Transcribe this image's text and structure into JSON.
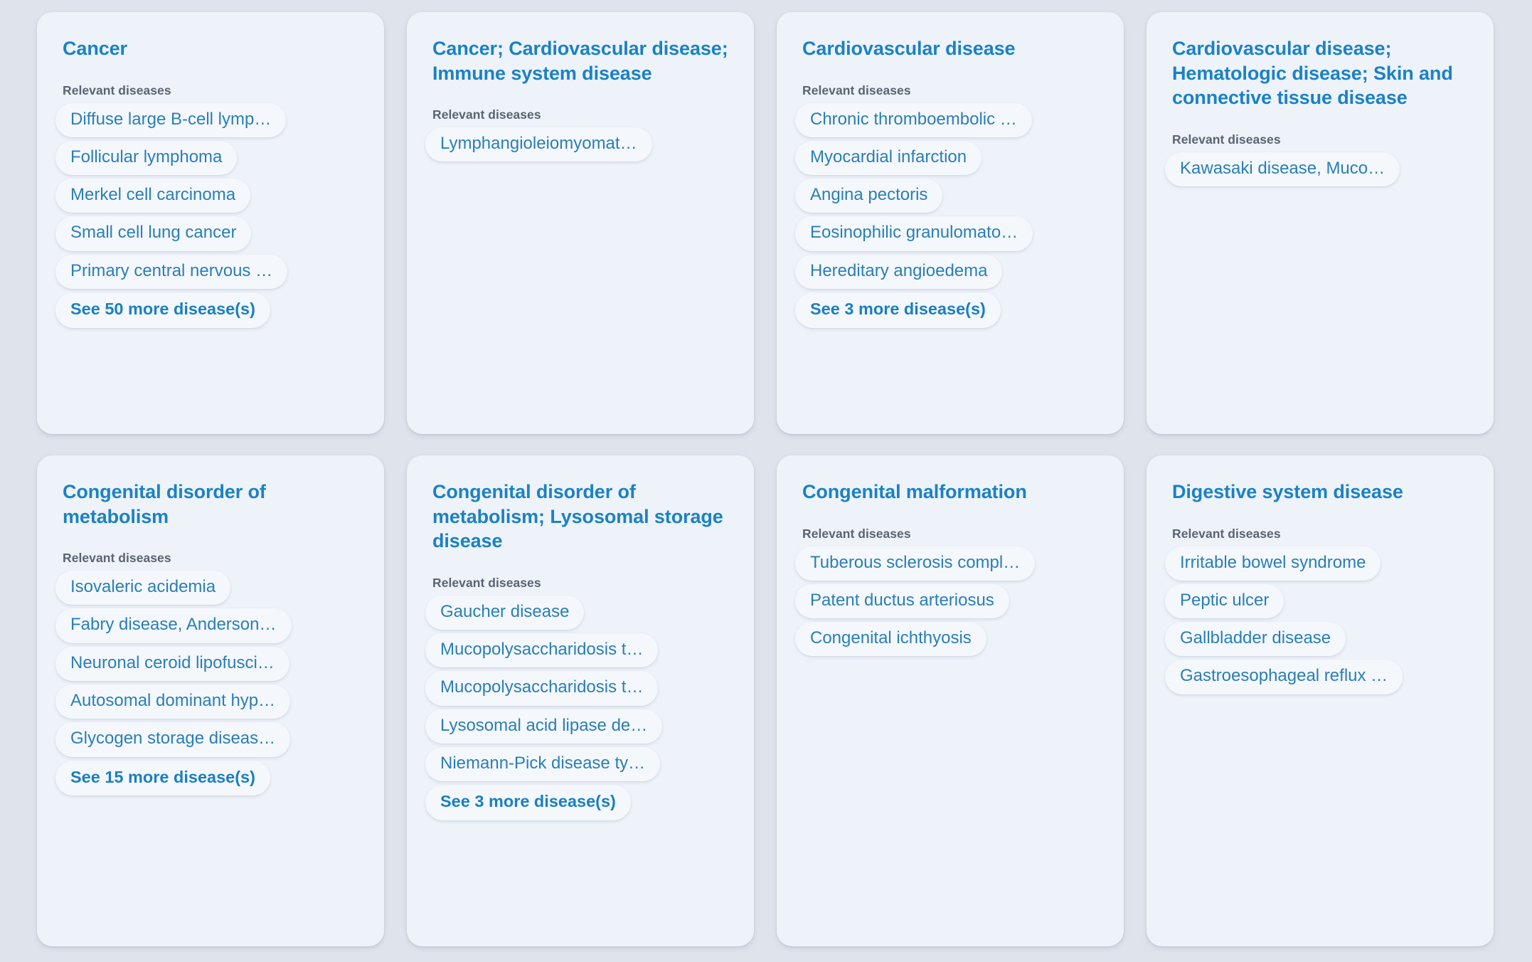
{
  "theme": {
    "page_background": "#dfe3ec",
    "card_background": "#eef2f9",
    "title_color": "#1a82c4",
    "label_color": "#5a6472",
    "chip_background": "#f4f7fc",
    "chip_text_color": "#2a7fb5",
    "more_link_color": "#1a7fc1"
  },
  "labels": {
    "relevant_diseases": "Relevant diseases"
  },
  "cards": [
    {
      "title": "Cancer",
      "section_label": "Relevant diseases",
      "diseases": [
        "Diffuse large B-cell lymp…",
        "Follicular lymphoma",
        "Merkel cell carcinoma",
        "Small cell lung cancer",
        "Primary central nervous …"
      ],
      "more_label": "See 50 more disease(s)",
      "more_count": 50
    },
    {
      "title": "Cancer; Cardiovascular disease; Immune system disease",
      "section_label": "Relevant diseases",
      "diseases": [
        "Lymphangioleiomyomat…"
      ],
      "more_label": null,
      "more_count": 0
    },
    {
      "title": "Cardiovascular disease",
      "section_label": "Relevant diseases",
      "diseases": [
        "Chronic thromboembolic …",
        "Myocardial infarction",
        "Angina pectoris",
        "Eosinophilic granulomato…",
        "Hereditary angioedema"
      ],
      "more_label": "See 3 more disease(s)",
      "more_count": 3
    },
    {
      "title": "Cardiovascular disease; Hematologic disease; Skin and connective tissue disease",
      "section_label": "Relevant diseases",
      "diseases": [
        "Kawasaki disease, Muco…"
      ],
      "more_label": null,
      "more_count": 0
    },
    {
      "title": "Congenital disorder of metabolism",
      "section_label": "Relevant diseases",
      "diseases": [
        "Isovaleric acidemia",
        "Fabry disease, Anderson…",
        "Neuronal ceroid lipofusci…",
        "Autosomal dominant hyp…",
        "Glycogen storage diseas…"
      ],
      "more_label": "See 15 more disease(s)",
      "more_count": 15
    },
    {
      "title": "Congenital disorder of metabolism; Lysosomal storage disease",
      "section_label": "Relevant diseases",
      "diseases": [
        "Gaucher disease",
        "Mucopolysaccharidosis t…",
        "Mucopolysaccharidosis t…",
        "Lysosomal acid lipase de…",
        "Niemann-Pick disease ty…"
      ],
      "more_label": "See 3 more disease(s)",
      "more_count": 3
    },
    {
      "title": "Congenital malformation",
      "section_label": "Relevant diseases",
      "diseases": [
        "Tuberous sclerosis compl…",
        "Patent ductus arteriosus",
        "Congenital ichthyosis"
      ],
      "more_label": null,
      "more_count": 0
    },
    {
      "title": "Digestive system disease",
      "section_label": "Relevant diseases",
      "diseases": [
        "Irritable bowel syndrome",
        "Peptic ulcer",
        "Gallbladder disease",
        "Gastroesophageal reflux …"
      ],
      "more_label": null,
      "more_count": 0
    }
  ]
}
